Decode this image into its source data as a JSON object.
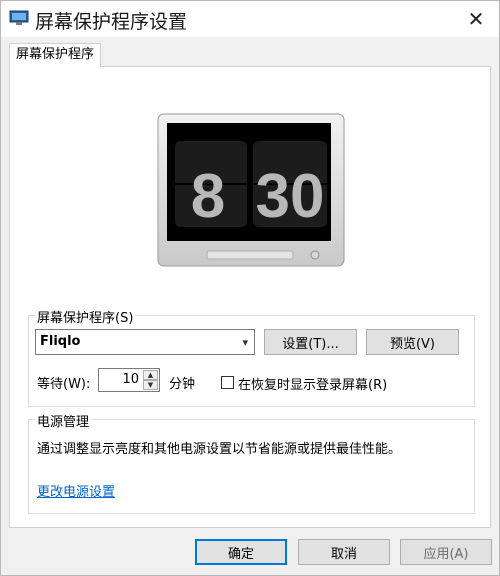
{
  "window": {
    "title": "屏幕保护程序设置",
    "close_symbol": "✕"
  },
  "tabs": [
    {
      "label": "屏幕保护程序"
    }
  ],
  "preview": {
    "clock_hour": "8",
    "clock_minute": "30"
  },
  "screensaver": {
    "group_title": "屏幕保护程序(S)",
    "selected": "Fliqlo",
    "settings_button": "设置(T)...",
    "preview_button": "预览(V)",
    "wait_label": "等待(W):",
    "wait_value": "10",
    "wait_unit": "分钟",
    "resume_checkbox_label": "在恢复时显示登录屏幕(R)",
    "resume_checked": false
  },
  "power": {
    "group_title": "电源管理",
    "description": "通过调整显示亮度和其他电源设置以节省能源或提供最佳性能。",
    "link": "更改电源设置"
  },
  "footer": {
    "ok": "确定",
    "cancel": "取消",
    "apply": "应用(A)"
  },
  "colors": {
    "link": "#0066cc",
    "accent": "#0078d7"
  },
  "icons": {
    "app": "display-properties-icon",
    "dropdown": "chevron-down-icon",
    "spin_up": "spin-up-icon",
    "spin_down": "spin-down-icon"
  }
}
